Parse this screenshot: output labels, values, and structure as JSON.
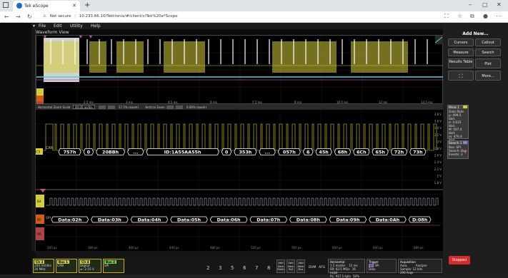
{
  "browser": {
    "tab_title": "Tek eScope",
    "new_tab_icon": "+",
    "url_warning": "Not secure",
    "url": "10.233.66.10/Tektronix/#/client/c/Tek%20e*Scope"
  },
  "menu": {
    "items": [
      "File",
      "Edit",
      "Utility",
      "Help"
    ]
  },
  "waveform_view": {
    "title": "Waveform View"
  },
  "zoom_bar": {
    "h_scale_label": "Horizontal Zoom Scale",
    "h_scale_value": "40.00 us/div",
    "h_pos_value": "57.5% (zoom)",
    "v_zoom_label": "Vertical Zoom",
    "v_zoom_value": "0.00% (zoom)"
  },
  "overview_time_labels": [
    "2.5 ms",
    "3 ms",
    "4.5 ms",
    "6 ms",
    "7.5 ms",
    "9 ms",
    "10.5 ms",
    "12 ms",
    "13.5 ms"
  ],
  "voltage_labels": [
    "3.8 V",
    "3.6 V",
    "3.4 V",
    "3.2 V",
    "3 V",
    "2.8 V",
    "2.6 V",
    "2.4 V",
    "2.2 V",
    "2 V",
    "1.8 V"
  ],
  "can_bus": {
    "label": "CAN",
    "ch_label": "C3",
    "fields": [
      "757h",
      "0",
      "20BBh",
      "...",
      "ID:1A55AA55h",
      "0",
      "353h",
      "...",
      "057h",
      "6",
      "45h",
      "68h",
      "6Ch",
      "65h",
      "72h",
      "73h"
    ]
  },
  "spi_bus": {
    "label": "SPI",
    "fields": [
      "Data:02h",
      "Data:03h",
      "Data:04h",
      "Data:05h",
      "Data:06h",
      "Data:07h",
      "Data:08h",
      "Data:09h",
      "Data:0Ah",
      "D:08h"
    ]
  },
  "digital_channel_labels": [
    "D4",
    "D5",
    "D6"
  ],
  "main_time_labels": [
    "320 µs",
    "360 µs",
    "400 µs",
    "440 µs",
    "480 µs",
    "520 µs",
    "560 µs",
    "600 µs",
    "640 µs",
    "680 µs"
  ],
  "right_panel": {
    "add_new": "Add New...",
    "buttons": [
      "Cursors",
      "Callout",
      "Measure",
      "Search",
      "Results Table",
      "Plot",
      "More..."
    ],
    "meas": {
      "title": "Meas 1",
      "lines": [
        "Data Rate",
        "µ: 499.5 kb/s",
        "σ: 4.635 kb/s",
        "M: 507.4 kb/s",
        "m: 476.4 kb/s",
        "N: 189"
      ]
    },
    "search": {
      "title": "Search 1",
      "lines": [
        "Bus: SPI",
        "Search: Bus",
        "Events: 3"
      ]
    },
    "stopped": "Stopped"
  },
  "bottom": {
    "ch3": {
      "title": "Ch 3",
      "lines": [
        "200 mV/div",
        "ᴬ",
        "20 MHz"
      ]
    },
    "bus1": {
      "title": "Bus 1",
      "lines": [
        "CAN"
      ]
    },
    "ch4": {
      "title": "Ch 4",
      "lines": [
        "Digital",
        "≠: 2.15 V"
      ]
    },
    "bus2": {
      "title": "Bus 2",
      "lines": [
        "SPI"
      ]
    },
    "channel_numbers": [
      "2",
      "3",
      "5",
      "6",
      "7",
      "8"
    ],
    "add_buttons": [
      [
        "Add",
        "New",
        "Math"
      ],
      [
        "Add",
        "New",
        "Ref"
      ],
      [
        "Add",
        "New",
        "Bus"
      ]
    ],
    "dvm": "DVM",
    "afg": "AFG",
    "horizontal": {
      "title": "Horizontal",
      "lines": [
        "1.5 ms/div",
        "15 ms",
        "SR: 62.5 MS/s",
        "16 ns/pt",
        "RL: 937.5 kpts",
        "50%"
      ]
    },
    "trigger": {
      "title": "Trigger",
      "lines": [
        "SPI",
        "Data"
      ]
    },
    "acquisition": {
      "title": "Acquisition",
      "lines": [
        "Auto,",
        "Analyze",
        "Sample: 12 bits",
        "290 Acqs"
      ]
    }
  },
  "colors": {
    "ch3": "#d4cc3b",
    "bus": "#ffffff",
    "digital": "#c9cfd6",
    "accent": "#c8b400",
    "stopped": "#d82c2c"
  }
}
